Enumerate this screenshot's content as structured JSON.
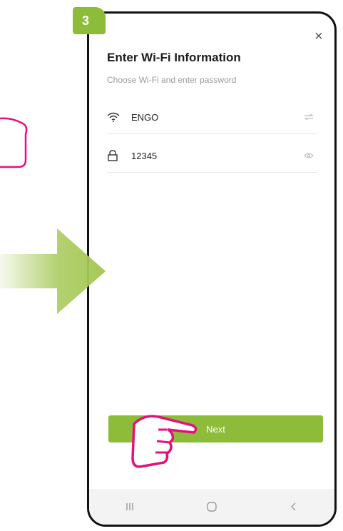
{
  "step": {
    "number": "3"
  },
  "dialog": {
    "title": "Enter Wi-Fi Information",
    "subtitle": "Choose Wi-Fi and enter password",
    "close_glyph": "×"
  },
  "wifi": {
    "ssid": "ENGO",
    "icon": "wifi-icon",
    "action_icon": "swap-icon"
  },
  "password": {
    "value": "12345",
    "icon": "lock-icon",
    "action_icon": "eye-icon"
  },
  "next_button": {
    "label": "Next"
  },
  "nav": {
    "items": [
      {
        "icon": "recent-apps-icon"
      },
      {
        "icon": "home-icon"
      },
      {
        "icon": "back-icon"
      }
    ]
  },
  "colors": {
    "accent": "#8cbc3a",
    "pointer": "#e2127a",
    "arrow": "#a6c957"
  }
}
